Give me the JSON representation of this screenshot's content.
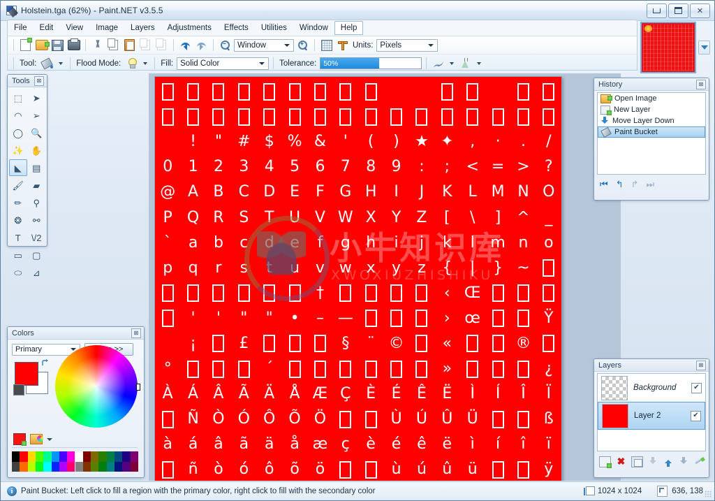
{
  "window": {
    "title": "Holstein.tga (62%) - Paint.NET v3.5.5",
    "app_icon": "paintnet-icon",
    "minimize": "–",
    "maximize": "□",
    "close": "✕"
  },
  "menu": {
    "items": [
      {
        "label": "File"
      },
      {
        "label": "Edit"
      },
      {
        "label": "View"
      },
      {
        "label": "Image"
      },
      {
        "label": "Layers"
      },
      {
        "label": "Adjustments"
      },
      {
        "label": "Effects"
      },
      {
        "label": "Utilities"
      },
      {
        "label": "Window"
      },
      {
        "label": "Help"
      }
    ]
  },
  "toolbar_main": {
    "buttons": [
      {
        "name": "new-image-button",
        "icon": "new-file-icon"
      },
      {
        "name": "open-image-button",
        "icon": "open-folder-icon"
      },
      {
        "name": "save-image-button",
        "icon": "save-disk-icon"
      },
      {
        "name": "print-image-button",
        "icon": "printer-icon"
      },
      {
        "name": "cut-button",
        "icon": "scissors-icon"
      },
      {
        "name": "copy-button",
        "icon": "copy-icon"
      },
      {
        "name": "paste-button",
        "icon": "clipboard-paste-icon"
      },
      {
        "name": "crop-to-selection-button",
        "icon": "crop-icon"
      },
      {
        "name": "deselect-all-button",
        "icon": "deselect-icon"
      },
      {
        "name": "undo-button",
        "icon": "undo-arrow-icon"
      },
      {
        "name": "redo-button",
        "icon": "redo-arrow-icon"
      },
      {
        "name": "zoom-out-button",
        "icon": "zoom-out-icon"
      },
      {
        "name": "zoom-in-button",
        "icon": "zoom-in-icon"
      },
      {
        "name": "toggle-grid-button",
        "icon": "grid-icon"
      },
      {
        "name": "toggle-rulers-button",
        "icon": "ruler-icon"
      }
    ],
    "zoom_value": "Window",
    "units_label": "Units:",
    "units_value": "Pixels"
  },
  "toolbar_tool": {
    "tool_label": "Tool:",
    "tool_icon": "paint-bucket-icon",
    "flood_mode_label": "Flood Mode:",
    "flood_mode_icon": "lightbulb-icon",
    "fill_label": "Fill:",
    "fill_value": "Solid Color",
    "tolerance_label": "Tolerance:",
    "tolerance_value": "50%",
    "tolerance_percent": 50,
    "antialias_icon": "antialiasing-curve-icon",
    "blend_icon": "blend-flask-icon"
  },
  "tools_panel": {
    "title": "Tools",
    "close": "⊠",
    "selected": "paint-bucket",
    "tools": [
      {
        "name": "rectangle-select-tool",
        "glyph": "⬚"
      },
      {
        "name": "move-selected-tool",
        "glyph": "➤"
      },
      {
        "name": "lasso-select-tool",
        "glyph": "◠"
      },
      {
        "name": "move-selection-tool",
        "glyph": "➢"
      },
      {
        "name": "ellipse-select-tool",
        "glyph": "◯"
      },
      {
        "name": "zoom-tool",
        "glyph": "🔍"
      },
      {
        "name": "magic-wand-tool",
        "glyph": "✨"
      },
      {
        "name": "pan-tool",
        "glyph": "✋"
      },
      {
        "name": "paint-bucket-tool",
        "glyph": "◣"
      },
      {
        "name": "gradient-tool",
        "glyph": "▤"
      },
      {
        "name": "paintbrush-tool",
        "glyph": "🖌"
      },
      {
        "name": "eraser-tool",
        "glyph": "▰"
      },
      {
        "name": "pencil-tool",
        "glyph": "✏"
      },
      {
        "name": "color-picker-tool",
        "glyph": "⚲"
      },
      {
        "name": "clone-stamp-tool",
        "glyph": "❂"
      },
      {
        "name": "recolor-tool",
        "glyph": "⚯"
      },
      {
        "name": "text-tool",
        "glyph": "T"
      },
      {
        "name": "line-curve-tool",
        "glyph": "\\/2"
      },
      {
        "name": "rectangle-shape-tool",
        "glyph": "▭"
      },
      {
        "name": "rounded-rectangle-tool",
        "glyph": "▢"
      },
      {
        "name": "ellipse-shape-tool",
        "glyph": "⬭"
      },
      {
        "name": "freeform-shape-tool",
        "glyph": "⊿"
      }
    ]
  },
  "colors_panel": {
    "title": "Colors",
    "close": "⊠",
    "mode_value": "Primary",
    "more_button": "More >>",
    "primary_color": "#fe0000",
    "secondary_color": "#ffffff",
    "palette": [
      "#000000",
      "#404040",
      "#ff0000",
      "#ff6a00",
      "#ffd800",
      "#b6ff00",
      "#4cff00",
      "#00ff21",
      "#00ff90",
      "#00ffff",
      "#0094ff",
      "#0026ff",
      "#4800ff",
      "#b200ff",
      "#ff00dc",
      "#ff006e",
      "#ffffff",
      "#808080",
      "#7f0000",
      "#7f3300",
      "#7f6a00",
      "#5b7f00",
      "#267f00",
      "#007f0e",
      "#007f46",
      "#007f7f",
      "#004a7f",
      "#00137f",
      "#21007f",
      "#57007f",
      "#7f006e",
      "#7f0037"
    ]
  },
  "history_panel": {
    "title": "History",
    "close": "⊠",
    "items": [
      {
        "label": "Open Image",
        "icon": "open-folder-icon",
        "selected": false
      },
      {
        "label": "New Layer",
        "icon": "new-layer-icon",
        "selected": false
      },
      {
        "label": "Move Layer Down",
        "icon": "move-down-icon",
        "selected": false
      },
      {
        "label": "Paint Bucket",
        "icon": "paint-bucket-icon",
        "selected": true
      }
    ],
    "nav": [
      {
        "name": "rewind-all-button",
        "glyph": "⏮"
      },
      {
        "name": "undo-button",
        "glyph": "↰"
      },
      {
        "name": "redo-button",
        "glyph": "↱"
      },
      {
        "name": "forward-all-button",
        "glyph": "⏭"
      }
    ]
  },
  "layers_panel": {
    "title": "Layers",
    "close": "⊠",
    "items": [
      {
        "name": "Background",
        "thumb": "checker",
        "visible": "✔",
        "selected": false,
        "italic": true
      },
      {
        "name": "Layer 2",
        "thumb": "red",
        "visible": "✔",
        "selected": true,
        "italic": false
      }
    ],
    "buttons": [
      {
        "name": "add-new-layer-button",
        "icon": "new-layer-icon"
      },
      {
        "name": "delete-layer-button",
        "icon": "delete-x-icon"
      },
      {
        "name": "duplicate-layer-button",
        "icon": "duplicate-layer-icon"
      },
      {
        "name": "merge-layer-down-button",
        "icon": "merge-down-icon"
      },
      {
        "name": "move-layer-up-button",
        "icon": "arrow-up-icon"
      },
      {
        "name": "move-layer-down-button",
        "icon": "arrow-down-icon"
      },
      {
        "name": "layer-properties-button",
        "icon": "properties-icon"
      }
    ]
  },
  "canvas": {
    "background_color": "#fe0000",
    "glyph_color": "#ffffff",
    "columns": 16,
    "watermark_cn": "小牛知识库",
    "watermark_en": "XWOXIUZHISHIKU",
    "rows": [
      [
        "□",
        "□",
        "□",
        "□",
        "□",
        "□",
        "□",
        "□",
        "□",
        " ",
        " ",
        "□",
        "□",
        " ",
        "□",
        "□"
      ],
      [
        "□",
        "□",
        "□",
        "□",
        "□",
        "□",
        "□",
        "□",
        "□",
        "□",
        "□",
        "□",
        "□",
        "□",
        "□",
        "□"
      ],
      [
        " ",
        "!",
        "\"",
        "#",
        "$",
        "%",
        "&",
        "'",
        "(",
        ")",
        "★",
        "✦",
        ",",
        "·",
        ".",
        "/"
      ],
      [
        "0",
        "1",
        "2",
        "3",
        "4",
        "5",
        "6",
        "7",
        "8",
        "9",
        ":",
        ";",
        "<",
        "=",
        ">",
        "?"
      ],
      [
        "@",
        "A",
        "B",
        "C",
        "D",
        "E",
        "F",
        "G",
        "H",
        "I",
        "J",
        "K",
        "L",
        "M",
        "N",
        "O"
      ],
      [
        "P",
        "Q",
        "R",
        "S",
        "T",
        "U",
        "V",
        "W",
        "X",
        "Y",
        "Z",
        "[",
        "\\",
        "]",
        "^",
        "_"
      ],
      [
        "`",
        "a",
        "b",
        "c",
        "d",
        "e",
        "f",
        "g",
        "h",
        "i",
        "j",
        "k",
        "l",
        "m",
        "n",
        "o"
      ],
      [
        "p",
        "q",
        "r",
        "s",
        "t",
        "u",
        "v",
        "w",
        "x",
        "y",
        "z",
        "{",
        "|",
        "}",
        "~",
        "□"
      ],
      [
        "□",
        "□",
        "□",
        "□",
        "□",
        "□",
        "†",
        "□",
        "□",
        "□",
        "□",
        "‹",
        "Œ",
        "□",
        "□",
        "□"
      ],
      [
        "□",
        "'",
        "'",
        "\"",
        "\"",
        "•",
        "–",
        "—",
        "□",
        "□",
        "□",
        "›",
        "œ",
        "□",
        "□",
        "Ÿ"
      ],
      [
        " ",
        "¡",
        "□",
        "£",
        "□",
        "□",
        "□",
        "§",
        "¨",
        "©",
        "□",
        "«",
        "□",
        "□",
        "®",
        "□"
      ],
      [
        "°",
        "□",
        "□",
        "□",
        "´",
        "□",
        "□",
        "□",
        "□",
        "□",
        "□",
        "»",
        "□",
        "□",
        "□",
        "¿"
      ],
      [
        "À",
        "Á",
        "Â",
        "Ã",
        "Ä",
        "Å",
        "Æ",
        "Ç",
        "È",
        "É",
        "Ê",
        "Ë",
        "Ì",
        "Í",
        "Î",
        "Ï"
      ],
      [
        "□",
        "Ñ",
        "Ò",
        "Ó",
        "Ô",
        "Õ",
        "Ö",
        "□",
        "□",
        "Ù",
        "Ú",
        "Û",
        "Ü",
        "□",
        "□",
        "ß"
      ],
      [
        "à",
        "á",
        "â",
        "ã",
        "ä",
        "å",
        "æ",
        "ç",
        "è",
        "é",
        "ê",
        "ë",
        "ì",
        "í",
        "î",
        "ï"
      ],
      [
        "□",
        "ñ",
        "ò",
        "ó",
        "ô",
        "õ",
        "ö",
        "□",
        "□",
        "ù",
        "ú",
        "û",
        "ü",
        "□",
        "□",
        "ÿ"
      ]
    ]
  },
  "thumbnail": {
    "name": "image-thumbnail",
    "dropdown_icon": "chevron-down-icon"
  },
  "statusbar": {
    "info_icon": "info-icon",
    "hint": "Paint Bucket: Left click to fill a region with the primary color, right click to fill with the secondary color",
    "image_size": "1024 x 1024",
    "cursor_position": "636, 138"
  }
}
